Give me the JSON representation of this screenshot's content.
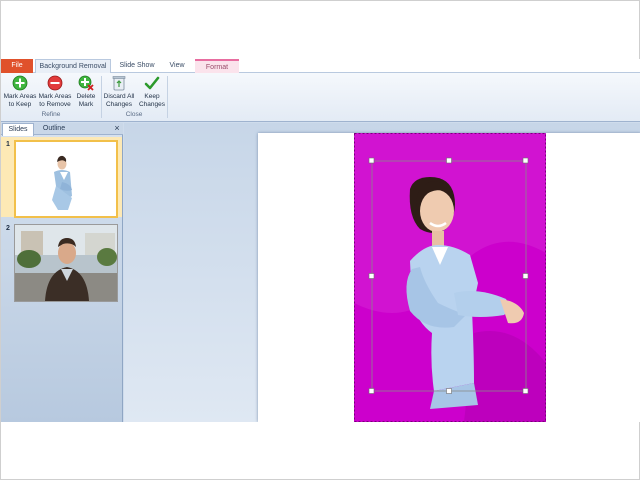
{
  "tabs": {
    "file": "File",
    "background_removal": "Background Removal",
    "slide_show": "Slide Show",
    "view": "View",
    "format": "Format"
  },
  "ribbon": {
    "mark_keep": [
      "Mark Areas",
      "to Keep"
    ],
    "mark_remove": [
      "Mark Areas",
      "to Remove"
    ],
    "delete_mark": [
      "Delete",
      "Mark"
    ],
    "discard_all": [
      "Discard All",
      "Changes"
    ],
    "keep_changes": [
      "Keep",
      "Changes"
    ],
    "group_refine": "Refine",
    "group_close": "Close"
  },
  "pane": {
    "tab_slides": "Slides",
    "tab_outline": "Outline",
    "close": "×",
    "slides": [
      {
        "number": "1"
      },
      {
        "number": "2"
      }
    ]
  },
  "colors": {
    "file_tab": "#e0512b",
    "removal_overlay": "#cc00cc",
    "selected_slide": "#fde9b5"
  }
}
